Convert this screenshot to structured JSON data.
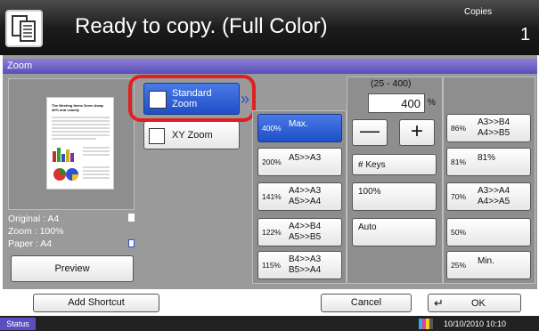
{
  "header": {
    "title": "Ready to copy. (Full Color)",
    "copies_label": "Copies",
    "copies_value": "1"
  },
  "zoom_bar": {
    "label": "Zoom"
  },
  "modes": {
    "standard": "Standard Zoom",
    "xy": "XY Zoom"
  },
  "preview_doc": {
    "heading": "The Meeting Items Seem Away 40% and exactly"
  },
  "info": {
    "original": "Original  : A4",
    "zoom": "Zoom      : 100%",
    "paper": "Paper     : A4",
    "preview": "Preview"
  },
  "presets_left": [
    {
      "pct": "400%",
      "label": "Max.",
      "selected": true
    },
    {
      "pct": "200%",
      "label": "A5>>A3"
    },
    {
      "pct": "141%",
      "label": "A4>>A3\nA5>>A4"
    },
    {
      "pct": "122%",
      "label": "A4>>B4\nA5>>B5"
    },
    {
      "pct": "115%",
      "label": "B4>>A3\nB5>>A4"
    }
  ],
  "manual": {
    "range": "(25 - 400)",
    "value": "400",
    "unit": "%",
    "minus": "—",
    "plus": "+",
    "keys": "# Keys",
    "hundred": "100%",
    "auto": "Auto"
  },
  "presets_right": [
    {
      "pct": "86%",
      "label": "A3>>B4\nA4>>B5"
    },
    {
      "pct": "81%",
      "label": "81%"
    },
    {
      "pct": "70%",
      "label": "A3>>A4\nA4>>A5"
    },
    {
      "pct": "50%",
      "label": ""
    },
    {
      "pct": "25%",
      "label": "Min."
    }
  ],
  "bottom": {
    "add_shortcut": "Add Shortcut",
    "cancel": "Cancel",
    "ok": "OK"
  },
  "statusbar": {
    "status": "Status",
    "datetime": "10/10/2010  10:10"
  },
  "colors": {
    "accent": "#1e4fc8",
    "highlight": "#e02020",
    "zoombar": "#5a4fb8"
  }
}
